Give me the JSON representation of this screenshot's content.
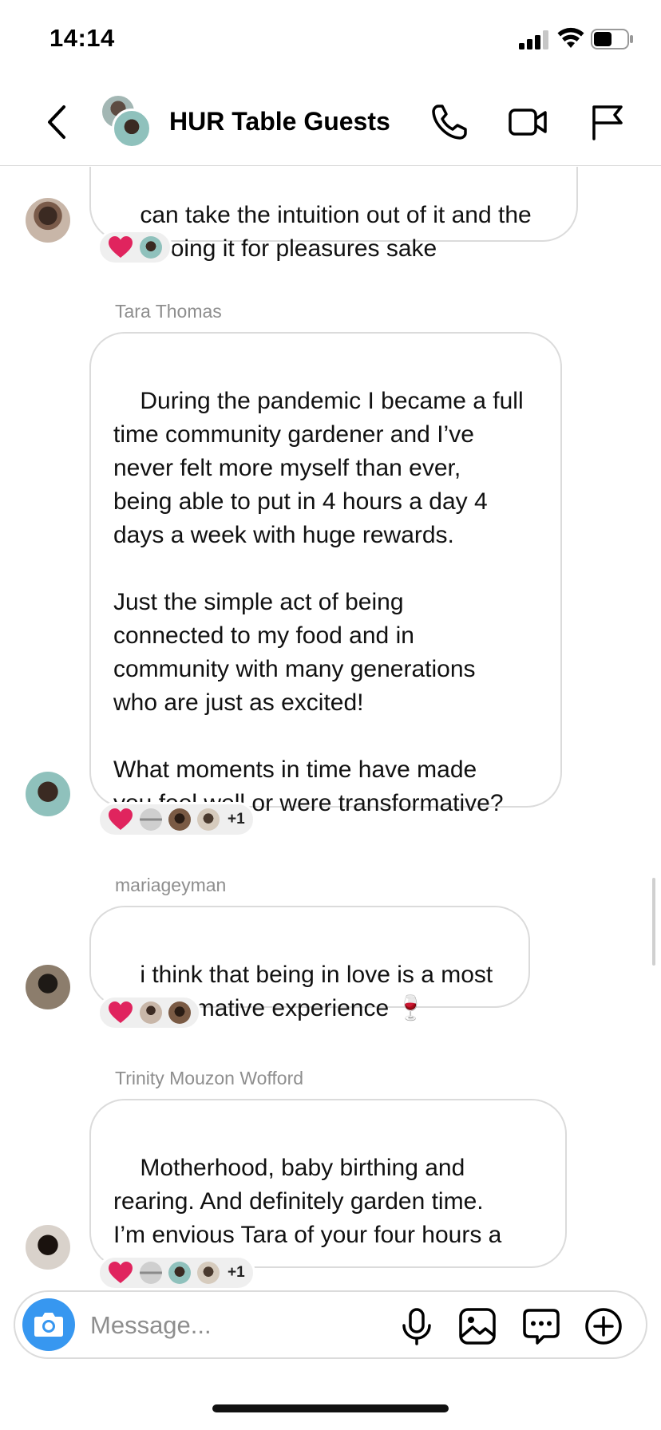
{
  "status_bar": {
    "time": "14:14",
    "battery_level": 0.55
  },
  "header": {
    "title": "HUR Table Guests"
  },
  "messages": [
    {
      "sender": "",
      "text": "can take the intuition out of it and the\njust doing it for pleasures sake",
      "reaction_more": ""
    },
    {
      "sender": "Tara Thomas",
      "text": "During the pandemic I became a full\ntime community gardener and I’ve\nnever felt more myself than ever,\nbeing able to put in 4 hours a day 4\ndays a week with huge rewards.\n\nJust the simple act of being\nconnected to my food and in\ncommunity with many generations\nwho are just as excited!\n\nWhat moments in time have made\nyou feel well or were transformative?",
      "reaction_more": "+1"
    },
    {
      "sender": "mariageyman",
      "text": "i think that being in love is a most\ntransformative experience 🍷",
      "reaction_more": ""
    },
    {
      "sender": "Trinity Mouzon Wofford",
      "text": "Motherhood, baby birthing and\nrearing. And definitely garden time.\nI’m envious Tara of your four hours a\nday!",
      "reaction_more": "+1"
    }
  ],
  "composer": {
    "placeholder": "Message..."
  },
  "colors": {
    "accent": "#3797f0",
    "heart": "#e0245e",
    "bubble_border": "#dbdbdb",
    "sender_gray": "#8e8e8e"
  }
}
